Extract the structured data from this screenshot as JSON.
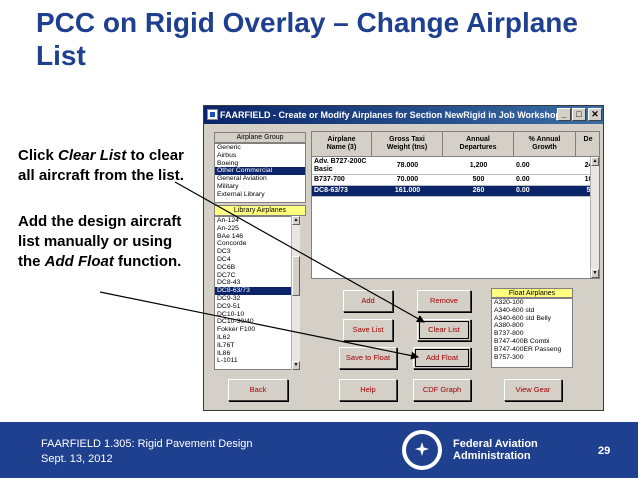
{
  "slide": {
    "title": "PCC on Rigid Overlay – Change Airplane List",
    "para1_pre": "Click ",
    "para1_em": "Clear List",
    "para1_post": " to clear all aircraft from the list.",
    "para2_pre": "Add the design aircraft list manually or using the ",
    "para2_em": "Add Float",
    "para2_post": " function."
  },
  "window": {
    "title": "FAARFIELD - Create or Modify Airplanes for Section NewRigid in Job Workshop",
    "min_glyph": "_",
    "max_glyph": "□",
    "close_glyph": "✕"
  },
  "airplane_group": {
    "label": "Airplane Group",
    "items": [
      "Generic",
      "Airbus",
      "Boeing",
      "Other Commercial",
      "General Aviation",
      "Military",
      "External Library"
    ],
    "selected_index": 3
  },
  "library": {
    "label": "Library Airplanes",
    "items": [
      "An-124",
      "An-225",
      "BAe 146",
      "Concorde",
      "DC3",
      "DC4",
      "DC6B",
      "DC7C",
      "DC8-43",
      "DC8-63/73",
      "DC9-32",
      "DC9-51",
      "DC10-10",
      "DC10-30/40",
      "Fokker F100",
      "IL62",
      "IL76T",
      "IL86",
      "L-1011"
    ],
    "selected_index": 9
  },
  "grid": {
    "headers": [
      "Airplane\nName (3)",
      "Gross Taxi\nWeight (tns)",
      "Annual\nDepartures",
      "% Annual\nGrowth",
      "De"
    ],
    "rows": [
      {
        "name": "Adv. B727-200C Basic",
        "weight": "78.000",
        "departures": "1,200",
        "growth": "0.00",
        "extra": "24"
      },
      {
        "name": "B737-700",
        "weight": "70.000",
        "departures": "500",
        "growth": "0.00",
        "extra": "10"
      },
      {
        "name": "DC8-63/73",
        "weight": "161.000",
        "departures": "260",
        "growth": "0.00",
        "extra": "5"
      }
    ],
    "selected_row": 2
  },
  "buttons": {
    "add": "Add",
    "remove": "Remove",
    "save_list": "Save List",
    "clear_list": "Clear List",
    "save_to_float": "Save to Float",
    "add_float": "Add Float",
    "back": "Back",
    "help": "Help",
    "cdf_graph": "CDF Graph",
    "view_gear": "View Gear"
  },
  "float_airplanes": {
    "label": "Float Airplanes",
    "items": [
      "A320-100",
      "A340-600 std",
      "A340-600 std Belly",
      "A380-800",
      "B737-800",
      "B747-400B Combi",
      "B747-400ER Passeng",
      "B757-300"
    ]
  },
  "footer": {
    "line1": "FAARFIELD 1.305: Rigid Pavement Design",
    "line2": "Sept. 13, 2012",
    "agency1": "Federal Aviation",
    "agency2": "Administration",
    "page": "29",
    "seal_text": "FEDERAL AVIATION ADMINISTRATION"
  },
  "colors": {
    "title_blue": "#1f3f8f",
    "footer_blue": "#1f3f8f",
    "selection": "#0a246a",
    "button_text": "#a00000"
  }
}
